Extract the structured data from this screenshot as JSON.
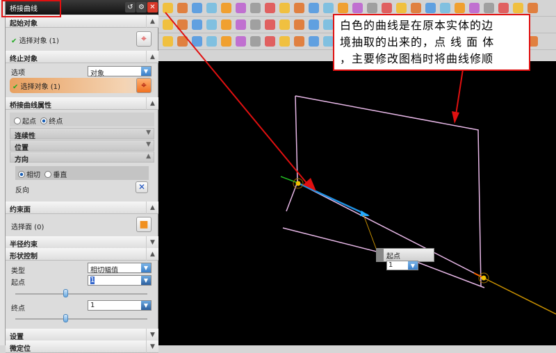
{
  "dialog": {
    "title": "桥接曲线",
    "start_object": {
      "header": "起始对象",
      "select": "选择对象 (1)"
    },
    "end_object": {
      "header": "终止对象",
      "option_label": "选项",
      "option_value": "对象",
      "select": "选择对象 (1)"
    },
    "bridge_props": {
      "header": "桥接曲线属性",
      "radio_start": "起点",
      "radio_end": "终点",
      "selected": "终点",
      "continuity": "连续性",
      "position": "位置",
      "direction": "方向",
      "dir_tangent": "相切",
      "dir_normal": "垂直",
      "dir_selected": "相切",
      "reverse": "反向"
    },
    "constraint_face": {
      "header": "约束面",
      "select": "选择面 (0)"
    },
    "radius_constraint": {
      "header": "半径约束"
    },
    "shape_control": {
      "header": "形状控制",
      "type_label": "类型",
      "type_value": "相切幅值",
      "start_label": "起点",
      "start_value": "1",
      "end_label": "终点",
      "end_value": "1",
      "start_slider_fraction": 0.38,
      "end_slider_fraction": 0.38
    },
    "settings": {
      "header": "设置"
    },
    "fine_position": {
      "header": "微定位"
    }
  },
  "annotation": {
    "lines": [
      "白色的曲线是在原本实体的边",
      "境抽取的出来的，点 线 面 体",
      "，主要修改图档时将曲线修顺"
    ],
    "border_color": "#e01010"
  },
  "quick_tip": {
    "label": "起点",
    "value": "1"
  },
  "colors": {
    "curve": "#e8b8e8",
    "arrow": "#e01010",
    "tangent": "#1e90e0",
    "bridge": "#c89000"
  }
}
